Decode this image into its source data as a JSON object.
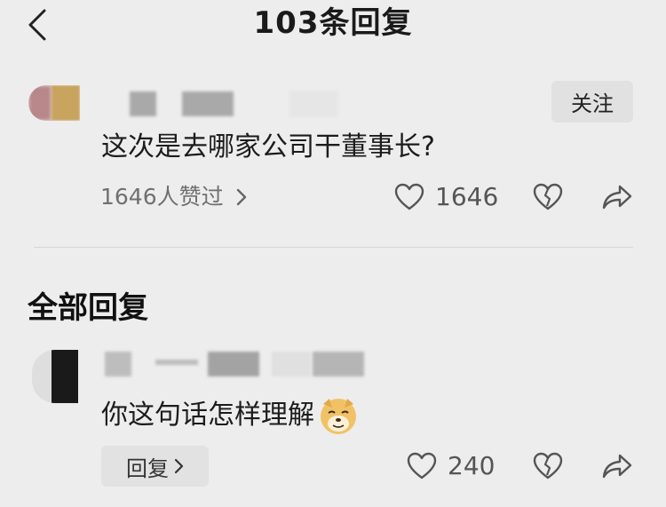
{
  "header": {
    "title": "103条回复"
  },
  "main_comment": {
    "follow_label": "关注",
    "text": "这次是去哪家公司干董事长?",
    "likers_summary": "1646人赞过",
    "like_count": "1646"
  },
  "replies_section": {
    "title": "全部回复"
  },
  "reply": {
    "text": "你这句话怎样理解",
    "reply_label": "回复",
    "like_count": "240"
  }
}
